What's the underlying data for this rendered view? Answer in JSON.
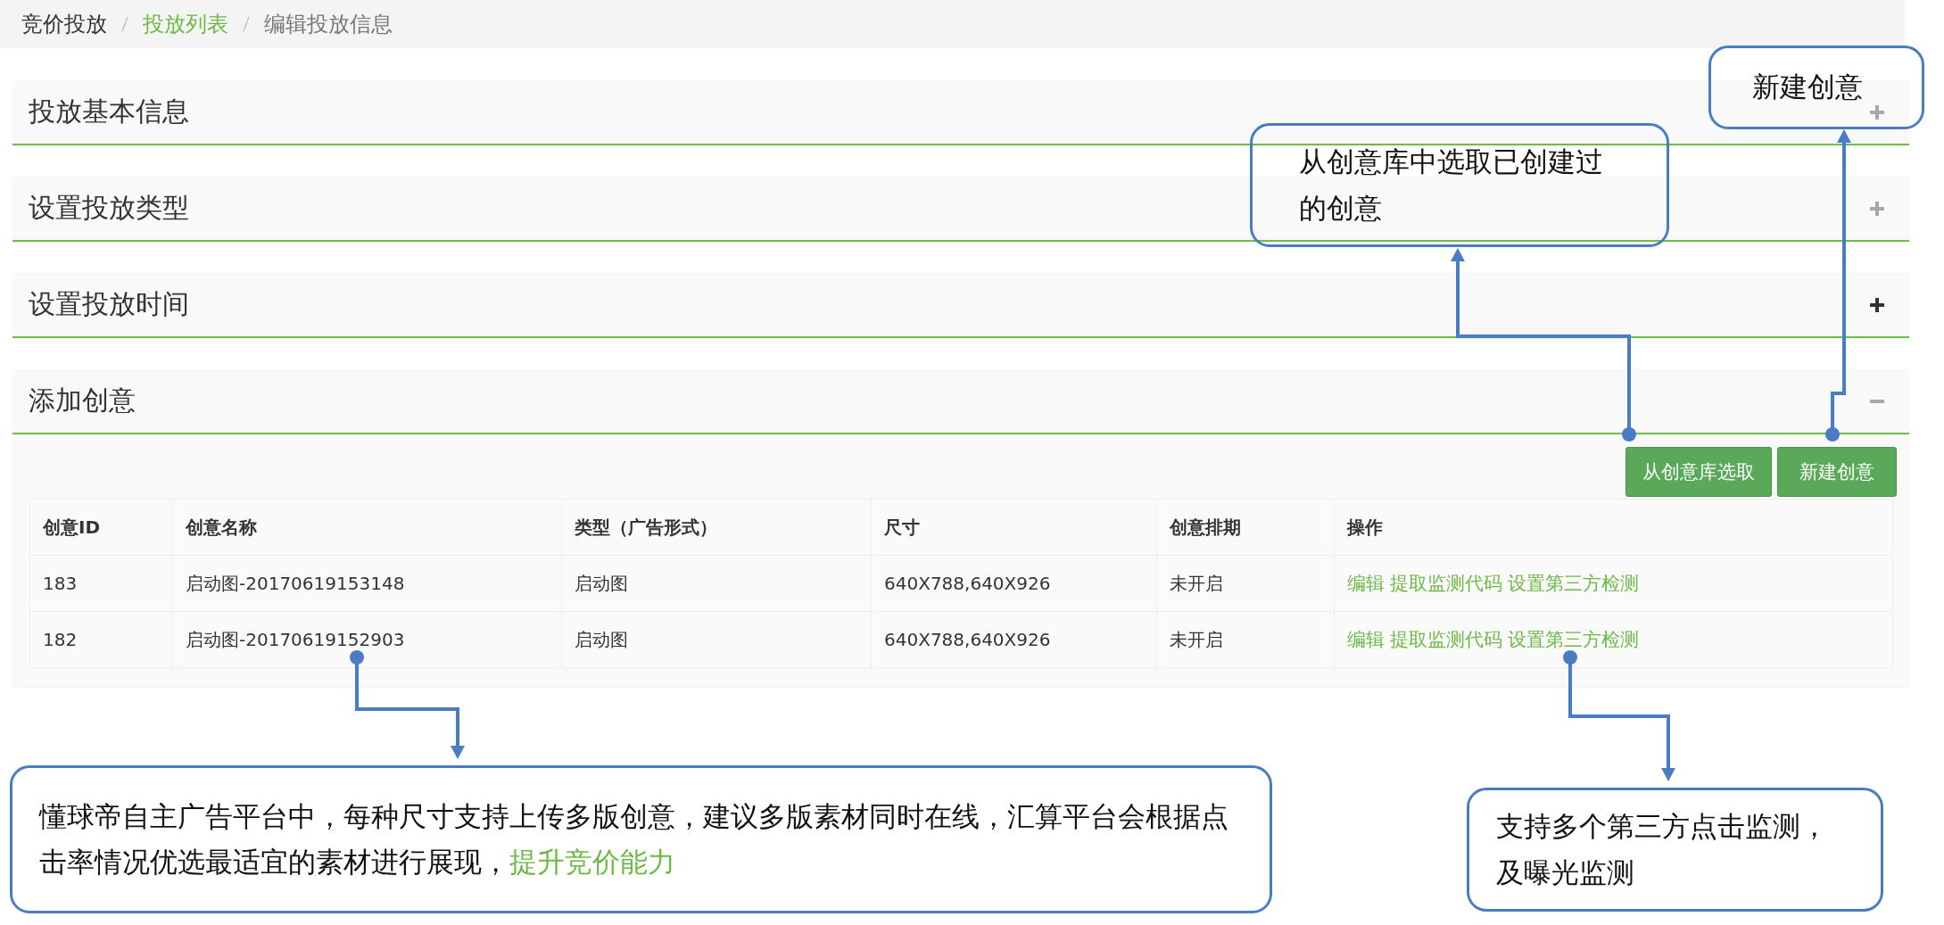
{
  "breadcrumb": [
    {
      "label": "竞价投放",
      "current": false,
      "link": false
    },
    {
      "label": "投放列表",
      "current": false,
      "link": true
    },
    {
      "label": "编辑投放信息",
      "current": true,
      "link": false
    }
  ],
  "panels": [
    {
      "title": "投放基本信息",
      "expanded": false,
      "hover": false
    },
    {
      "title": "设置投放类型",
      "expanded": false,
      "hover": false
    },
    {
      "title": "设置投放时间",
      "expanded": false,
      "hover": true
    },
    {
      "title": "添加创意",
      "expanded": true,
      "hover": false
    }
  ],
  "actions": [
    "从创意库选取",
    "新建创意"
  ],
  "table": {
    "columns": [
      "创意ID",
      "创意名称",
      "类型（广告形式）",
      "尺寸",
      "创意排期",
      "操作"
    ],
    "rows": [
      {
        "cells": [
          "183",
          "启动图-20170619153148",
          "启动图",
          "640X788,640X926",
          "未开启"
        ],
        "links": [
          "编辑",
          "提取监测代码",
          "设置第三方检测"
        ]
      },
      {
        "cells": [
          "182",
          "启动图-20170619152903",
          "启动图",
          "640X788,640X926",
          "未开启"
        ],
        "links": [
          "编辑",
          "提取监测代码",
          "设置第三方检测"
        ]
      }
    ]
  },
  "callouts": [
    {
      "segments": [
        {
          "text": "新建创意",
          "highlight": false
        }
      ]
    },
    {
      "segments": [
        {
          "text": "从创意库中选取已创建过的创意",
          "highlight": false
        }
      ]
    },
    {
      "segments": [
        {
          "text": "懂球帝自主广告平台中，每种尺寸支持上传多版创意，建议多版素材同时在线，汇算平台会根据点击率情况优选最适宜的素材进行展现，",
          "highlight": false
        },
        {
          "text": "提升竞价能力",
          "highlight": true
        }
      ]
    },
    {
      "segments": [
        {
          "text": "支持多个第三方点击监测，及曝光监测",
          "highlight": false
        }
      ]
    }
  ]
}
